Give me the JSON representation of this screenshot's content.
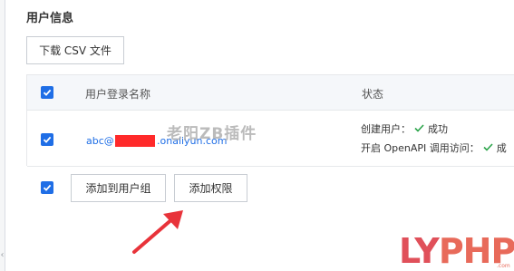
{
  "section": {
    "title": "用户信息"
  },
  "toolbar": {
    "download_label": "下载 CSV 文件"
  },
  "table": {
    "header": {
      "username_label": "用户登录名称",
      "status_label": "状态"
    },
    "rows": [
      {
        "email_prefix": "abc@",
        "email_domain": ".onaliyun.com",
        "status_create_label": "创建用户：",
        "status_create_value": "成功",
        "status_openapi_label": "开启 OpenAPI 调用访问：",
        "status_openapi_value": "成"
      }
    ]
  },
  "actions": {
    "add_to_group_label": "添加到用户组",
    "add_permission_label": "添加权限"
  },
  "watermark": {
    "text": "老阳ZB插件"
  },
  "logo": {
    "main_a": "LY",
    "main_b": "PHP",
    "sub": ".com"
  },
  "colors": {
    "accent": "#1f6ee6",
    "success": "#2ba44a",
    "annotation_red": "#e8333a",
    "redaction": "#ff2a2a"
  },
  "icons": {
    "checkbox": "checkbox-checked-icon",
    "success": "check-icon",
    "collapse": "chevron-left-icon"
  }
}
